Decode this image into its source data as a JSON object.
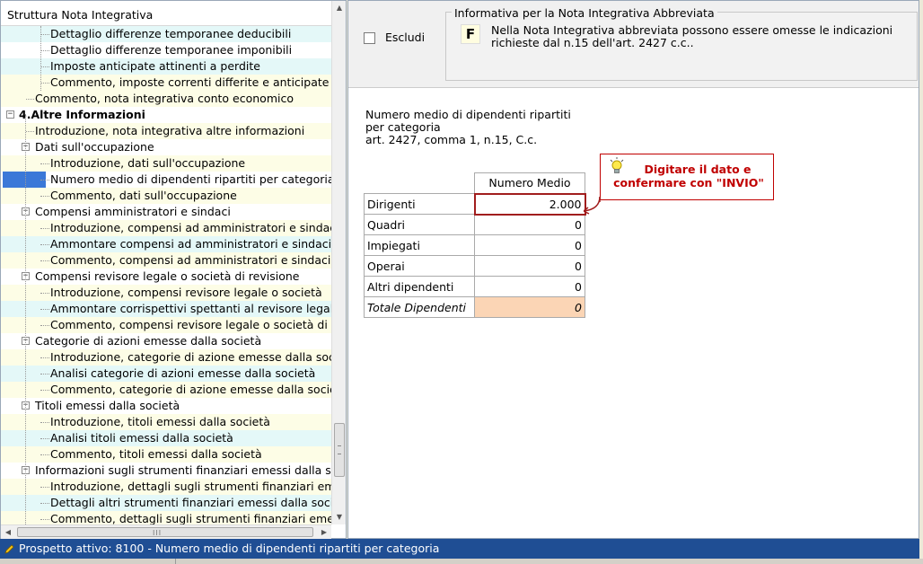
{
  "tree": {
    "header": "Struttura Nota Integrativa",
    "rows": [
      {
        "label": "Dettaglio differenze temporanee deducibili",
        "level": 3,
        "style": "cyan"
      },
      {
        "label": "Dettaglio differenze temporanee imponibili",
        "level": 3,
        "style": "plain"
      },
      {
        "label": "Imposte anticipate attinenti a perdite",
        "level": 3,
        "style": "cyan"
      },
      {
        "label": "Commento, imposte correnti differite e anticipate",
        "level": 3,
        "style": "stripe"
      },
      {
        "label": "Commento, nota integrativa conto economico",
        "level": 2,
        "style": "stripe"
      },
      {
        "label": "4.Altre Informazioni",
        "level": 0,
        "style": "bold",
        "expander": "−"
      },
      {
        "label": "Introduzione, nota integrativa altre informazioni",
        "level": 2,
        "style": "stripe"
      },
      {
        "label": "Dati sull'occupazione",
        "level": 1,
        "style": "plain",
        "expander": "−"
      },
      {
        "label": "Introduzione, dati sull'occupazione",
        "level": 3,
        "style": "stripe"
      },
      {
        "label": "Numero medio di dipendenti ripartiti per categoria",
        "level": 3,
        "style": "selected"
      },
      {
        "label": "Commento, dati sull'occupazione",
        "level": 3,
        "style": "stripe"
      },
      {
        "label": "Compensi amministratori e sindaci",
        "level": 1,
        "style": "plain",
        "expander": "−"
      },
      {
        "label": "Introduzione, compensi ad amministratori e sindaci",
        "level": 3,
        "style": "stripe"
      },
      {
        "label": "Ammontare compensi ad amministratori e sindaci",
        "level": 3,
        "style": "cyan"
      },
      {
        "label": "Commento, compensi ad amministratori e sindaci",
        "level": 3,
        "style": "stripe"
      },
      {
        "label": "Compensi revisore legale o società di revisione",
        "level": 1,
        "style": "plain",
        "expander": "−"
      },
      {
        "label": "Introduzione, compensi revisore legale o società",
        "level": 3,
        "style": "stripe"
      },
      {
        "label": "Ammontare corrispettivi spettanti al revisore legale",
        "level": 3,
        "style": "cyan"
      },
      {
        "label": "Commento, compensi revisore legale o società di",
        "level": 3,
        "style": "stripe"
      },
      {
        "label": "Categorie di azioni emesse dalla società",
        "level": 1,
        "style": "plain",
        "expander": "−"
      },
      {
        "label": "Introduzione, categorie di azione emesse dalla società",
        "level": 3,
        "style": "stripe"
      },
      {
        "label": "Analisi categorie di azioni emesse dalla società",
        "level": 3,
        "style": "cyan"
      },
      {
        "label": "Commento, categorie di azione emesse dalla società",
        "level": 3,
        "style": "stripe"
      },
      {
        "label": "Titoli emessi dalla società",
        "level": 1,
        "style": "plain",
        "expander": "−"
      },
      {
        "label": "Introduzione, titoli emessi dalla società",
        "level": 3,
        "style": "stripe"
      },
      {
        "label": "Analisi titoli emessi dalla società",
        "level": 3,
        "style": "cyan"
      },
      {
        "label": "Commento, titoli emessi dalla società",
        "level": 3,
        "style": "stripe"
      },
      {
        "label": "Informazioni sugli strumenti finanziari emessi dalla società",
        "level": 1,
        "style": "plain",
        "expander": "−"
      },
      {
        "label": "Introduzione, dettagli sugli strumenti finanziari emessi",
        "level": 3,
        "style": "stripe"
      },
      {
        "label": "Dettagli altri strumenti finanziari emessi dalla società",
        "level": 3,
        "style": "cyan"
      },
      {
        "label": "Commento, dettagli sugli strumenti finanziari emessi",
        "level": 3,
        "style": "stripe"
      }
    ]
  },
  "top": {
    "exclude_label": "Escludi",
    "exclude_checked": false,
    "info_title": "Informativa per la Nota Integrativa Abbreviata",
    "info_icon_letter": "F",
    "info_text": "Nella Nota Integrativa abbreviata possono essere omesse le indicazioni richieste dal n.15 dell'art. 2427 c.c.."
  },
  "description": {
    "line1": "Numero medio di dipendenti ripartiti",
    "line2": "per categoria",
    "line3": "art. 2427, comma 1, n.15, C.c."
  },
  "table": {
    "column_header": "Numero Medio",
    "rows": [
      {
        "label": "Dirigenti",
        "value": "2.000"
      },
      {
        "label": "Quadri",
        "value": "0"
      },
      {
        "label": "Impiegati",
        "value": "0"
      },
      {
        "label": "Operai",
        "value": "0"
      },
      {
        "label": "Altri dipendenti",
        "value": "0"
      }
    ],
    "total_label": "Totale Dipendenti",
    "total_value": "0"
  },
  "tooltip": {
    "text_line1": "Digitare il dato e",
    "text_line2": "confermare con \"INVIO\""
  },
  "status": {
    "text": "Prospetto attivo: 8100 - Numero medio di dipendenti ripartiti per categoria"
  },
  "colors": {
    "status_bar": "#1f4e94",
    "selection": "#3b78d8",
    "tooltip_accent": "#c00000",
    "total_cell": "#fbd5b5"
  }
}
